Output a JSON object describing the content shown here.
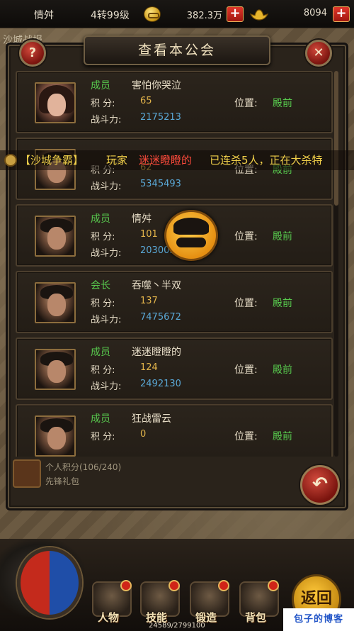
{
  "top_bar": {
    "player_name": "情舛",
    "level": "4转99级",
    "gold": "382.3万",
    "ingots": "8094",
    "plus_label": "+"
  },
  "background": {
    "tab_text": "沙城战报"
  },
  "panel": {
    "title": "查看本公会",
    "help_label": "?",
    "close_label": "✕",
    "back_label": "↶"
  },
  "member_labels": {
    "points": "积 分:",
    "power": "战斗力:",
    "position": "位置:"
  },
  "members": [
    {
      "rank": "成员",
      "name": "害怕你哭泣",
      "points": "65",
      "power": "2175213",
      "position": "殿前"
    },
    {
      "rank": "",
      "name": "",
      "points": "62",
      "power": "5345493",
      "position": "殿前"
    },
    {
      "rank": "成员",
      "name": "情舛",
      "points": "101",
      "power": "2030053",
      "position": "殿前"
    },
    {
      "rank": "会长",
      "name": "吞噬丶半双",
      "points": "137",
      "power": "7475672",
      "position": "殿前"
    },
    {
      "rank": "成员",
      "name": "迷迷瞪瞪的",
      "points": "124",
      "power": "2492130",
      "position": "殿前"
    },
    {
      "rank": "成员",
      "name": "狂战雷云",
      "points": "0",
      "power": "",
      "position": "殿前"
    }
  ],
  "marquee": {
    "tag": "【沙城争霸】",
    "prefix": "玩家",
    "player": "迷迷瞪瞪的",
    "message": "已连杀5人，正在大杀特"
  },
  "bonus": {
    "line1": "个人积分(106/240)",
    "line2": "先锋礼包"
  },
  "hud": {
    "buttons": [
      "人物",
      "技能",
      "锻造",
      "背包"
    ],
    "big_back": "返回",
    "exp": "24589/2799100"
  },
  "watermark": "包子的博客",
  "colors": {
    "rank_green": "#57c84d",
    "points_gold": "#e2b44a",
    "power_blue": "#5aa8d6",
    "marquee_yellow": "#f1d04a",
    "marquee_red": "#ff4b3c"
  }
}
